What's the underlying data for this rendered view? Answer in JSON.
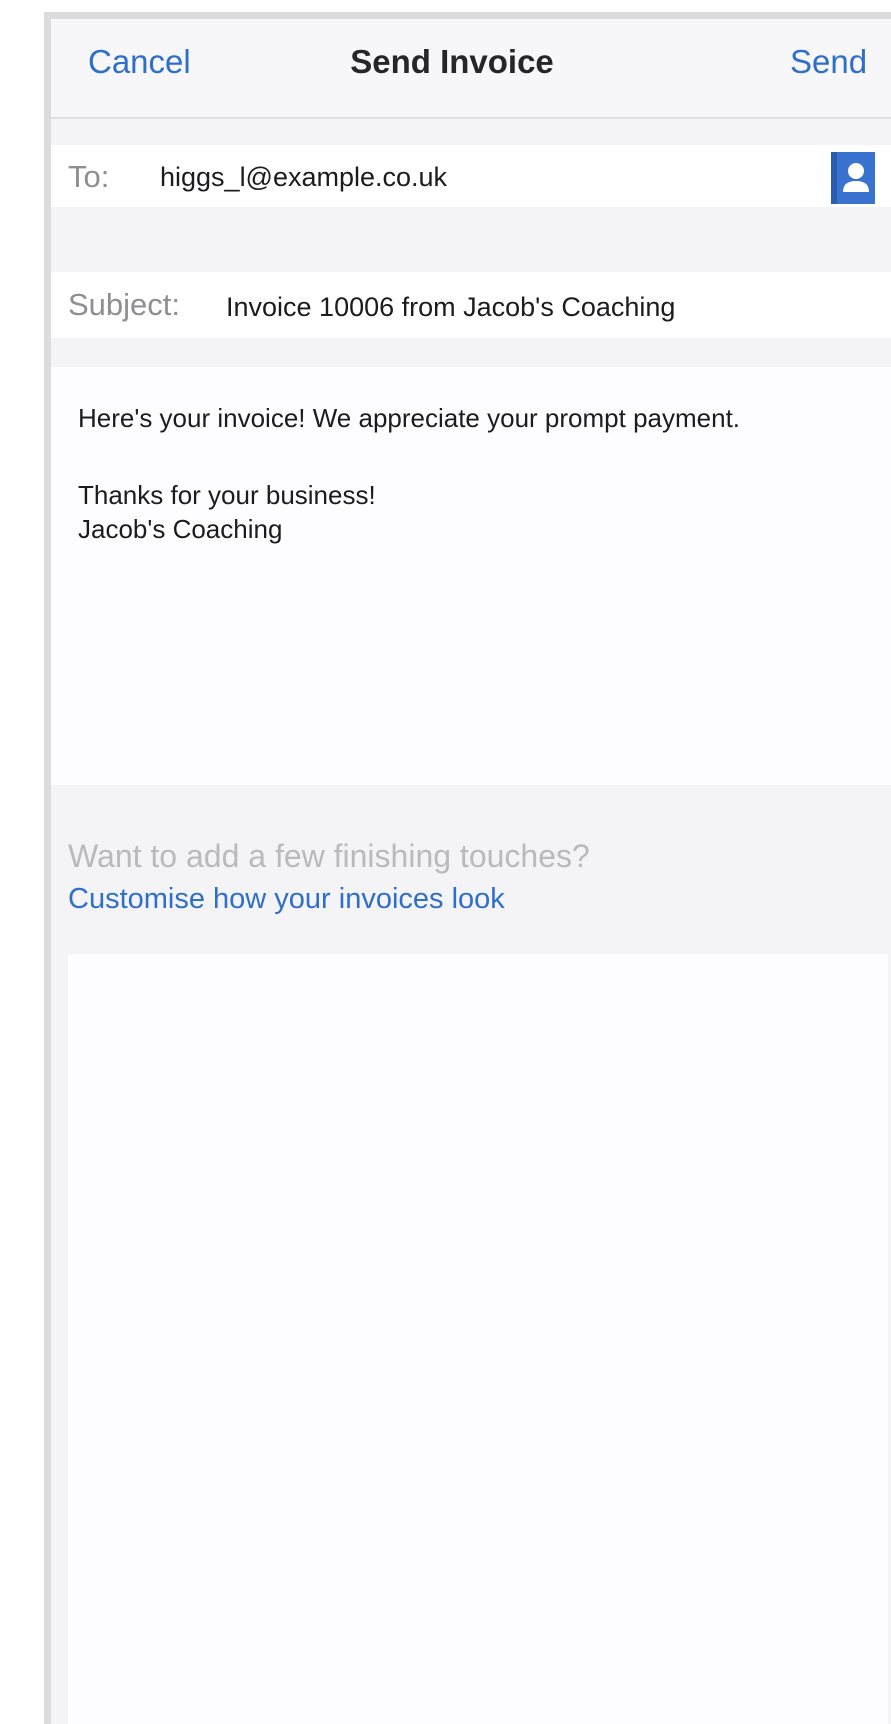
{
  "nav": {
    "cancel_label": "Cancel",
    "title": "Send Invoice",
    "send_label": "Send"
  },
  "compose": {
    "to_label": "To:",
    "to_value": "higgs_l@example.co.uk",
    "subject_label": "Subject:",
    "subject_value": "Invoice 10006 from Jacob's Coaching",
    "body_lines": [
      "Here's your invoice! We appreciate your prompt payment.",
      "Thanks for your business!",
      "Jacob's Coaching"
    ]
  },
  "finishing": {
    "prompt": "Want to add a few finishing touches?",
    "link": "Customise how your invoices look"
  },
  "icons": {
    "contact": "contact-card-icon"
  },
  "colors": {
    "accent": "#2f6ec9",
    "label_gray": "#8e8e93"
  }
}
